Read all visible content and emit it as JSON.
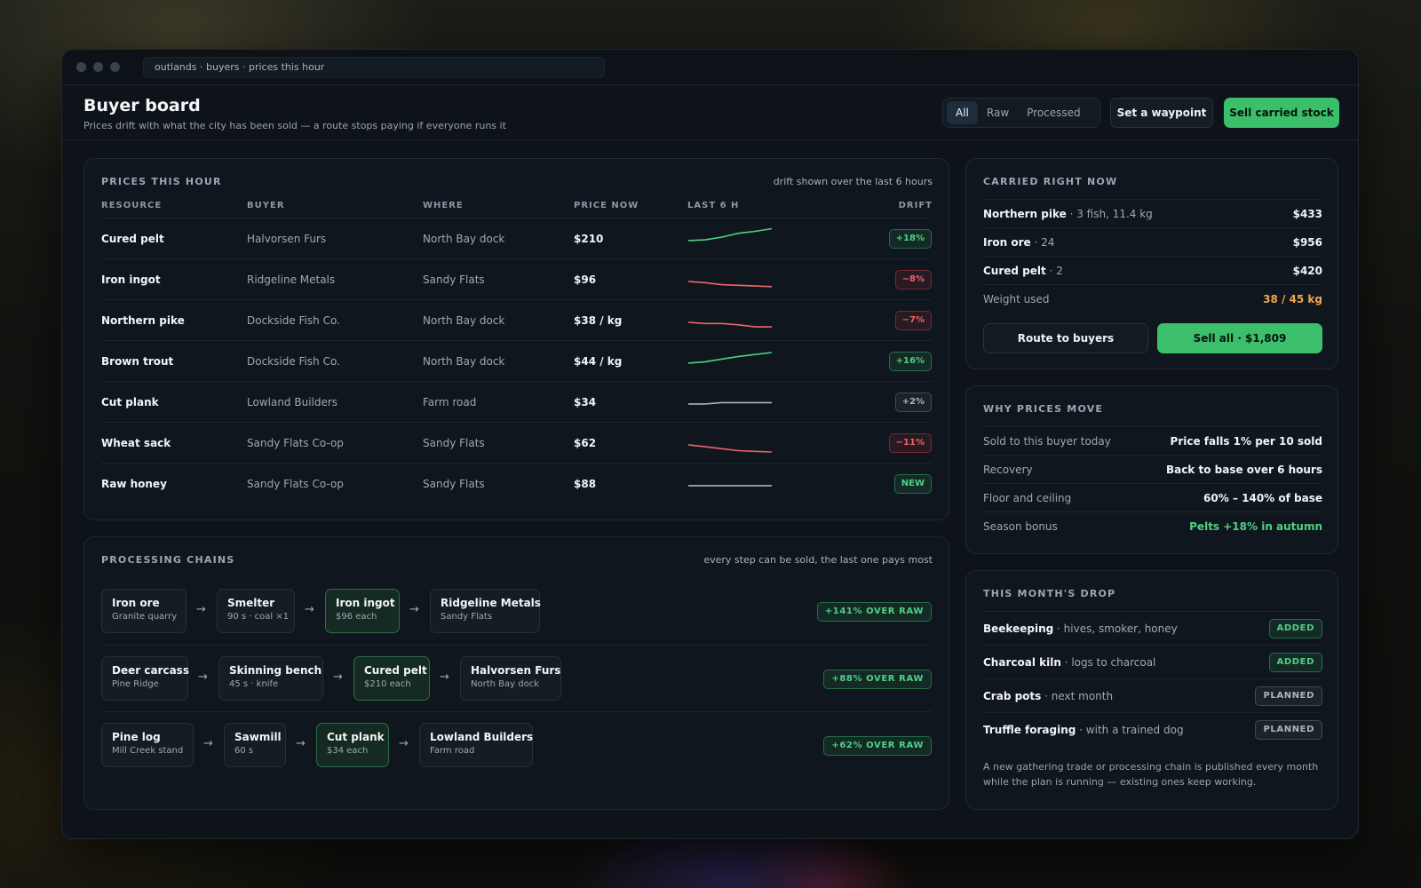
{
  "window": {
    "url": "outlands · buyers · prices this hour"
  },
  "header": {
    "title": "Buyer board",
    "subtitle": "Prices drift with what the city has been sold — a route stops paying if everyone runs it",
    "filters": [
      {
        "label": "All",
        "active": true
      },
      {
        "label": "Raw",
        "active": false
      },
      {
        "label": "Processed",
        "active": false
      }
    ],
    "waypoint_label": "Set a waypoint",
    "sell_label": "Sell carried stock"
  },
  "prices": {
    "title": "PRICES THIS HOUR",
    "note": "drift shown over the last 6 hours",
    "columns": [
      "RESOURCE",
      "BUYER",
      "WHERE",
      "PRICE NOW",
      "LAST 6 H",
      "DRIFT"
    ],
    "rows": [
      {
        "resource": "Cured pelt",
        "buyer": "Halvorsen Furs",
        "where": "North Bay dock",
        "price": "$210",
        "trend": [
          100,
          101,
          105,
          111,
          114,
          118
        ],
        "drift": "+18%",
        "kind": "up"
      },
      {
        "resource": "Iron ingot",
        "buyer": "Ridgeline Metals",
        "where": "Sandy Flats",
        "price": "$96",
        "trend": [
          100,
          98,
          95,
          94,
          93,
          92
        ],
        "drift": "−8%",
        "kind": "down"
      },
      {
        "resource": "Northern pike",
        "buyer": "Dockside Fish Co.",
        "where": "North Bay dock",
        "price": "$38 / kg",
        "trend": [
          100,
          98,
          98,
          96,
          93,
          93
        ],
        "drift": "−7%",
        "kind": "down"
      },
      {
        "resource": "Brown trout",
        "buyer": "Dockside Fish Co.",
        "where": "North Bay dock",
        "price": "$44 / kg",
        "trend": [
          100,
          102,
          106,
          110,
          113,
          116
        ],
        "drift": "+16%",
        "kind": "up"
      },
      {
        "resource": "Cut plank",
        "buyer": "Lowland Builders",
        "where": "Farm road",
        "price": "$34",
        "trend": [
          100,
          100,
          102,
          102,
          102,
          102
        ],
        "drift": "+2%",
        "kind": "flat"
      },
      {
        "resource": "Wheat sack",
        "buyer": "Sandy Flats Co-op",
        "where": "Sandy Flats",
        "price": "$62",
        "trend": [
          100,
          97,
          94,
          91,
          90,
          89
        ],
        "drift": "−11%",
        "kind": "down"
      },
      {
        "resource": "Raw honey",
        "buyer": "Sandy Flats Co-op",
        "where": "Sandy Flats",
        "price": "$88",
        "trend": [
          100,
          100,
          100,
          100,
          100,
          100
        ],
        "drift": "NEW",
        "kind": "new"
      }
    ]
  },
  "chains": {
    "title": "PROCESSING CHAINS",
    "note": "every step can be sold, the last one pays most",
    "items": [
      {
        "nodes": [
          {
            "name": "Iron ore",
            "sub": "Granite quarry"
          },
          {
            "name": "Smelter",
            "sub": "90 s · coal ×1"
          },
          {
            "name": "Iron ingot",
            "sub": "$96 each"
          },
          {
            "name": "Ridgeline Metals",
            "sub": "Sandy Flats"
          }
        ],
        "gain": "+141% OVER RAW"
      },
      {
        "nodes": [
          {
            "name": "Deer carcass",
            "sub": "Pine Ridge"
          },
          {
            "name": "Skinning bench",
            "sub": "45 s · knife"
          },
          {
            "name": "Cured pelt",
            "sub": "$210 each"
          },
          {
            "name": "Halvorsen Furs",
            "sub": "North Bay dock"
          }
        ],
        "gain": "+88% OVER RAW"
      },
      {
        "nodes": [
          {
            "name": "Pine log",
            "sub": "Mill Creek stand"
          },
          {
            "name": "Sawmill",
            "sub": "60 s"
          },
          {
            "name": "Cut plank",
            "sub": "$34 each"
          },
          {
            "name": "Lowland Builders",
            "sub": "Farm road"
          }
        ],
        "gain": "+62% OVER RAW"
      }
    ]
  },
  "carried": {
    "title": "CARRIED RIGHT NOW",
    "items": [
      {
        "name": "Northern pike",
        "detail": " · 3 fish, 11.4 kg",
        "value": "$433"
      },
      {
        "name": "Iron ore",
        "detail": " · 24",
        "value": "$956"
      },
      {
        "name": "Cured pelt",
        "detail": " · 2",
        "value": "$420"
      }
    ],
    "weight_label": "Weight used",
    "weight_value": "38 / 45 kg",
    "route_label": "Route to buyers",
    "sell_all_label": "Sell all · $1,809"
  },
  "why": {
    "title": "WHY PRICES MOVE",
    "items": [
      {
        "label": "Sold to this buyer today",
        "value": "Price falls 1% per 10 sold",
        "accent": false
      },
      {
        "label": "Recovery",
        "value": "Back to base over 6 hours",
        "accent": false
      },
      {
        "label": "Floor and ceiling",
        "value": "60% – 140% of base",
        "accent": false
      },
      {
        "label": "Season bonus",
        "value": "Pelts +18% in autumn",
        "accent": true
      }
    ]
  },
  "drop": {
    "title": "THIS MONTH'S DROP",
    "items": [
      {
        "name": "Beekeeping",
        "detail": " · hives, smoker, honey",
        "tag": "ADDED",
        "kind": "added"
      },
      {
        "name": "Charcoal kiln",
        "detail": " · logs to charcoal",
        "tag": "ADDED",
        "kind": "added"
      },
      {
        "name": "Crab pots",
        "detail": " · next month",
        "tag": "PLANNED",
        "kind": "planned"
      },
      {
        "name": "Truffle foraging",
        "detail": " · with a trained dog",
        "tag": "PLANNED",
        "kind": "planned"
      }
    ],
    "note": "A new gathering trade or processing chain is published every month while the plan is running — existing ones keep working."
  },
  "colors": {
    "accent_green": "#3bbf6a",
    "up": "#4fd183",
    "down": "#f0646a",
    "flat": "#aab4bf",
    "warning": "#f3a64a"
  }
}
